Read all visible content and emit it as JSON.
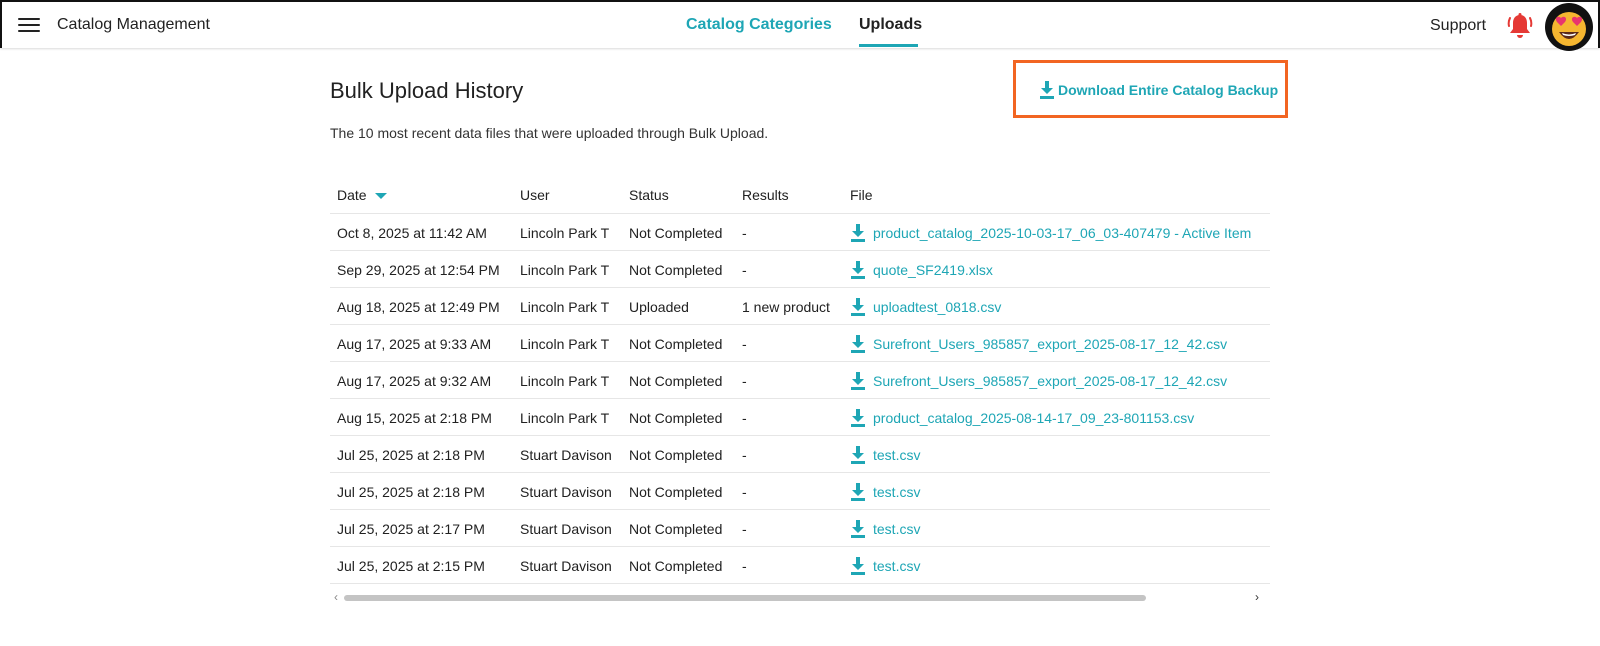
{
  "header": {
    "app_title": "Catalog Management",
    "tabs": [
      {
        "label": "Catalog Categories",
        "active": false
      },
      {
        "label": "Uploads",
        "active": true
      }
    ],
    "support_label": "Support",
    "icons": {
      "menu": "hamburger-menu-icon",
      "notifications": "bell-icon",
      "avatar": "heart-eyes-emoji-avatar"
    }
  },
  "page": {
    "title": "Bulk Upload History",
    "subtitle": "The 10 most recent data files that were uploaded through Bulk Upload.",
    "backup_button": "Download Entire Catalog Backup"
  },
  "table": {
    "columns": [
      "Date",
      "User",
      "Status",
      "Results",
      "File"
    ],
    "sorted_by": "Date",
    "sort_direction": "descending",
    "rows": [
      {
        "date": "Oct 8, 2025 at 11:42 AM",
        "user": "Lincoln Park T",
        "status": "Not Completed",
        "results": "-",
        "file": "product_catalog_2025-10-03-17_06_03-407479 - Active Item"
      },
      {
        "date": "Sep 29, 2025 at 12:54 PM",
        "user": "Lincoln Park T",
        "status": "Not Completed",
        "results": "-",
        "file": "quote_SF2419.xlsx"
      },
      {
        "date": "Aug 18, 2025 at 12:49 PM",
        "user": "Lincoln Park T",
        "status": "Uploaded",
        "results": "1 new product",
        "file": "uploadtest_0818.csv"
      },
      {
        "date": "Aug 17, 2025 at 9:33 AM",
        "user": "Lincoln Park T",
        "status": "Not Completed",
        "results": "-",
        "file": "Surefront_Users_985857_export_2025-08-17_12_42.csv"
      },
      {
        "date": "Aug 17, 2025 at 9:32 AM",
        "user": "Lincoln Park T",
        "status": "Not Completed",
        "results": "-",
        "file": "Surefront_Users_985857_export_2025-08-17_12_42.csv"
      },
      {
        "date": "Aug 15, 2025 at 2:18 PM",
        "user": "Lincoln Park T",
        "status": "Not Completed",
        "results": "-",
        "file": "product_catalog_2025-08-14-17_09_23-801153.csv"
      },
      {
        "date": "Jul 25, 2025 at 2:18 PM",
        "user": "Stuart Davison",
        "status": "Not Completed",
        "results": "-",
        "file": "test.csv"
      },
      {
        "date": "Jul 25, 2025 at 2:18 PM",
        "user": "Stuart Davison",
        "status": "Not Completed",
        "results": "-",
        "file": "test.csv"
      },
      {
        "date": "Jul 25, 2025 at 2:17 PM",
        "user": "Stuart Davison",
        "status": "Not Completed",
        "results": "-",
        "file": "test.csv"
      },
      {
        "date": "Jul 25, 2025 at 2:15 PM",
        "user": "Stuart Davison",
        "status": "Not Completed",
        "results": "-",
        "file": "test.csv"
      }
    ]
  },
  "scrollbar": {
    "left_arrow": "‹",
    "right_arrow": "›"
  },
  "colors": {
    "accent": "#1ea6b5",
    "highlight_border": "#f26522",
    "bell": "#e53935"
  }
}
